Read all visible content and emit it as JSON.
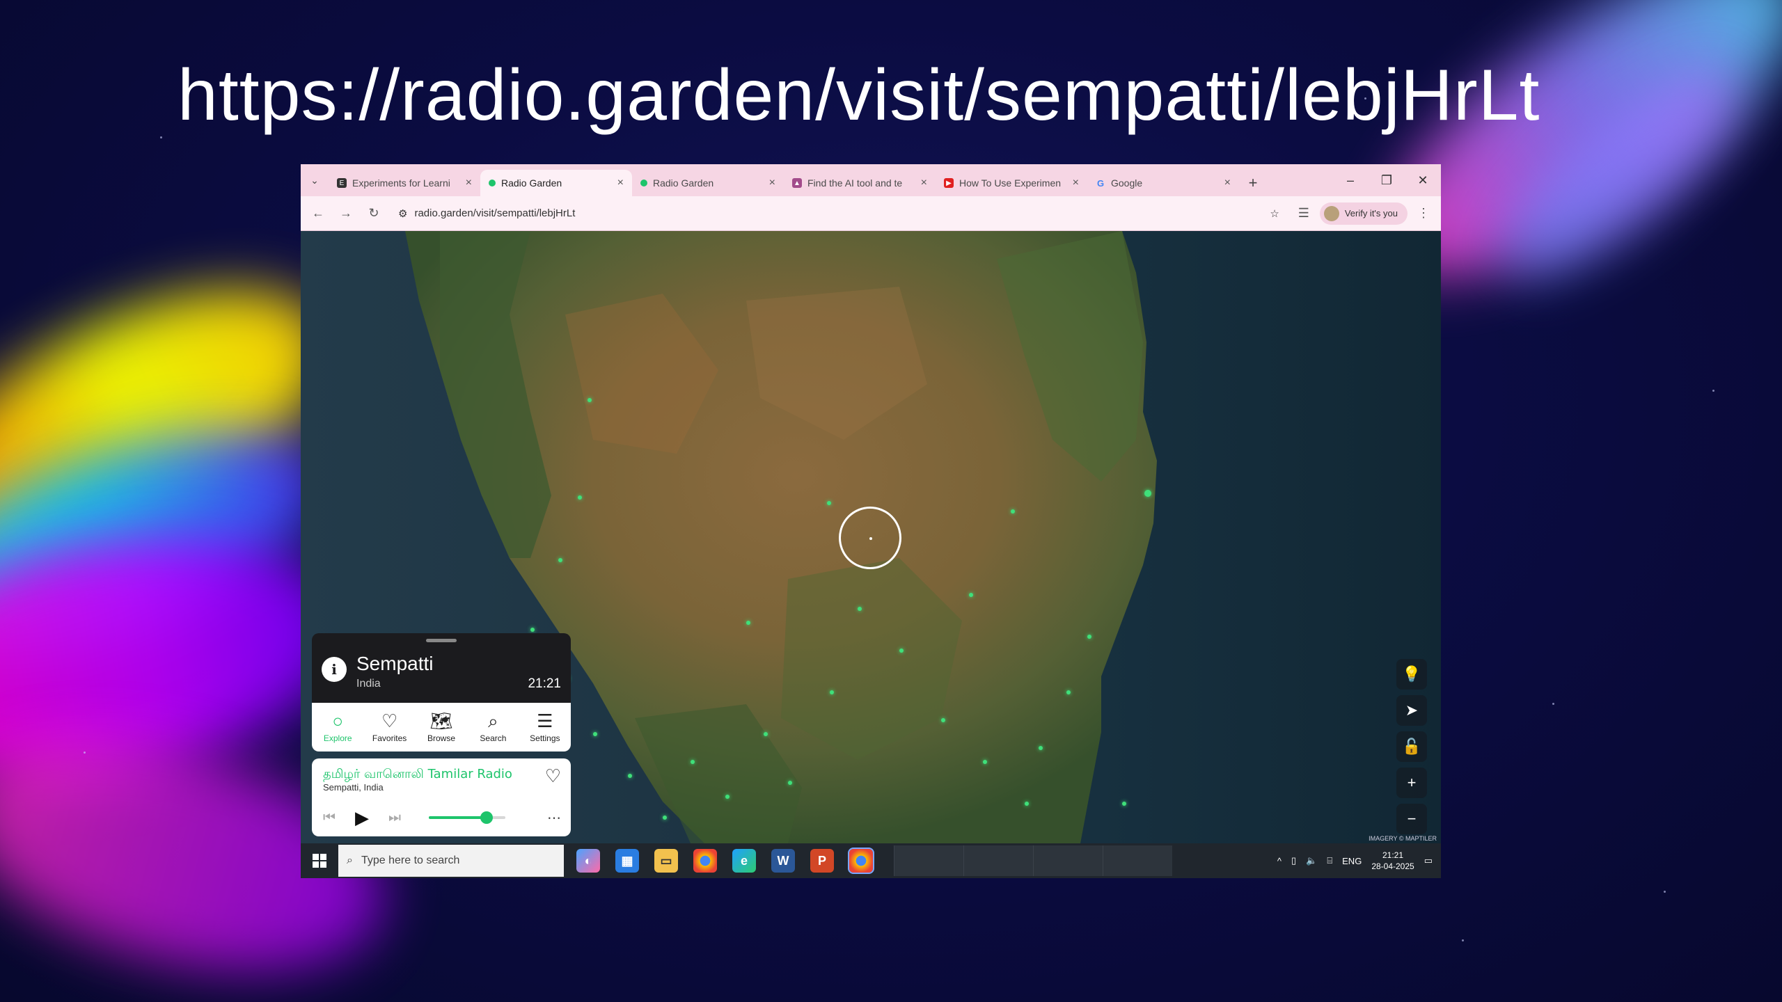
{
  "slide": {
    "title_url": "https://radio.garden/visit/sempatti/lebjHrLt"
  },
  "browser": {
    "tabs": [
      {
        "label": "Experiments for Learni",
        "icon": "experiments-favicon",
        "active": false
      },
      {
        "label": "Radio Garden",
        "icon": "radio-garden-favicon",
        "active": true
      },
      {
        "label": "Radio Garden",
        "icon": "radio-garden-favicon",
        "active": false
      },
      {
        "label": "Find the AI tool and te",
        "icon": "ai-tool-favicon",
        "active": false
      },
      {
        "label": "How To Use Experimen",
        "icon": "youtube-favicon",
        "active": false
      },
      {
        "label": "Google",
        "icon": "google-favicon",
        "active": false
      }
    ],
    "address": "radio.garden/visit/sempatti/lebjHrLt",
    "profile_chip": "Verify it's you"
  },
  "radio": {
    "place_name": "Sempatti",
    "place_country": "India",
    "local_time": "21:21",
    "nav": [
      {
        "label": "Explore",
        "icon": "explore-icon"
      },
      {
        "label": "Favorites",
        "icon": "heart-icon"
      },
      {
        "label": "Browse",
        "icon": "map-icon"
      },
      {
        "label": "Search",
        "icon": "search-icon"
      },
      {
        "label": "Settings",
        "icon": "menu-icon"
      }
    ],
    "station_name": "தமிழர் வானொலி Tamilar Radio",
    "station_location": "Sempatti, India",
    "volume_level": 0.75,
    "map_attribution": "IMAGERY © MAPTILER"
  },
  "taskbar": {
    "search_placeholder": "Type here to search",
    "language": "ENG",
    "time": "21:21",
    "date": "28-04-2025"
  },
  "colors": {
    "accent_green": "#1ec46b",
    "tab_strip": "#f6d6e4"
  }
}
